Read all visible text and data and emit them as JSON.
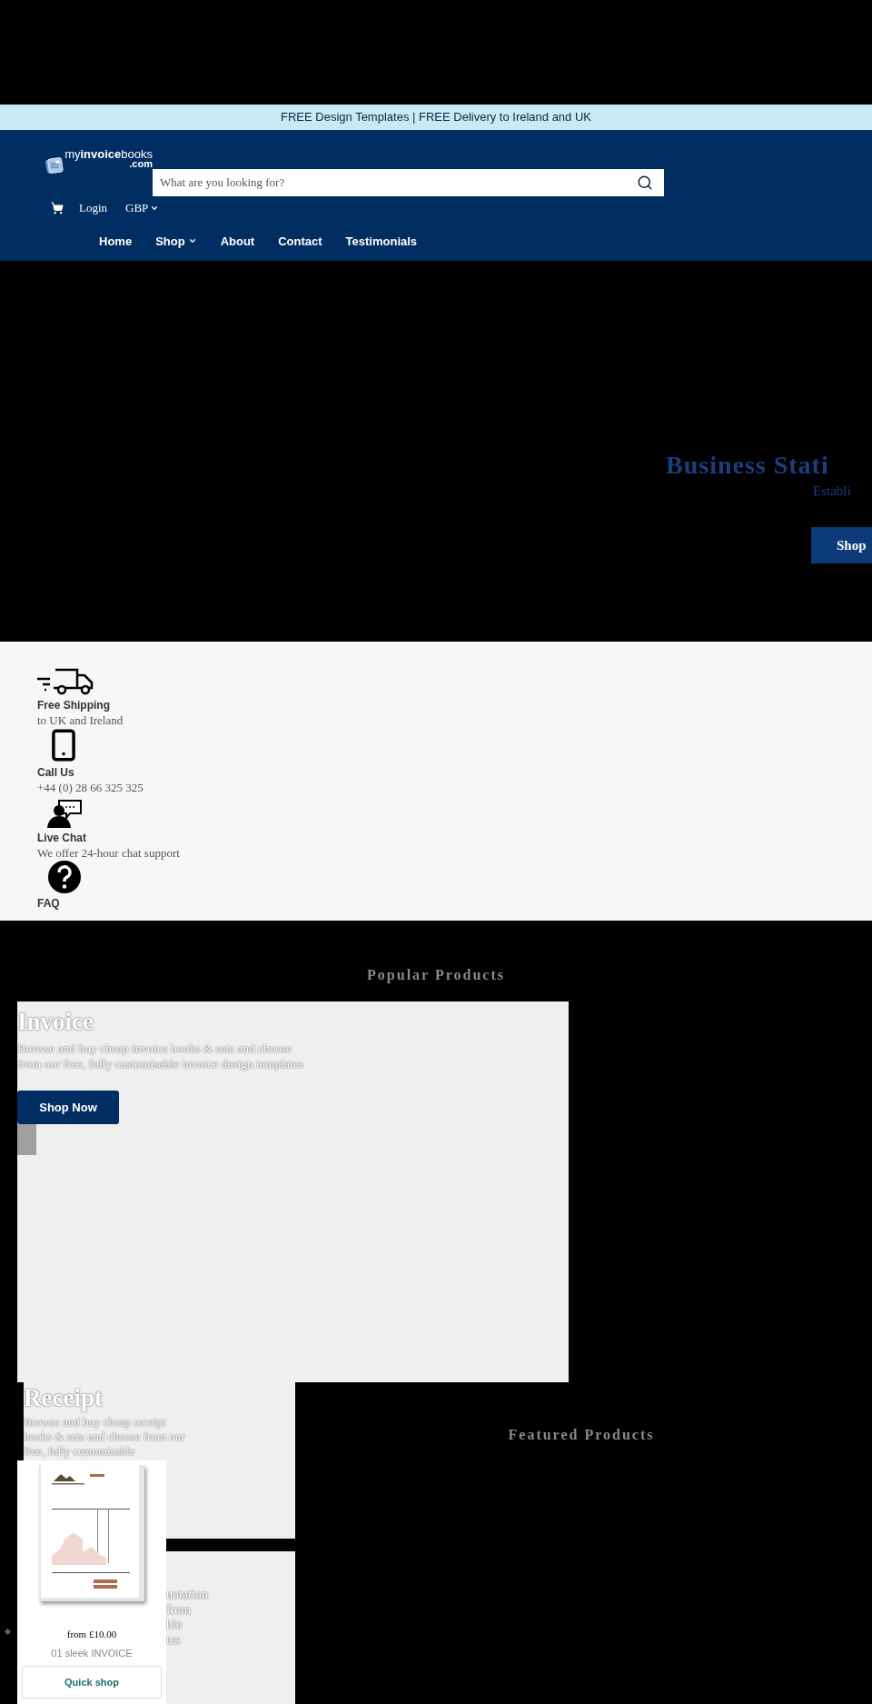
{
  "announcement": "FREE Design Templates | FREE Delivery to Ireland and UK",
  "header": {
    "logo": {
      "name": "my**invoice**books",
      "suffix": ".com"
    },
    "search": {
      "placeholder": "What are you looking for?"
    },
    "login": "Login",
    "currency": "GBP"
  },
  "nav": [
    {
      "label": "Home",
      "dropdown": false
    },
    {
      "label": "Shop",
      "dropdown": true
    },
    {
      "label": "About",
      "dropdown": false
    },
    {
      "label": "Contact",
      "dropdown": false
    },
    {
      "label": "Testimonials",
      "dropdown": false
    }
  ],
  "hero": {
    "title": "Business Stati",
    "subtitle": "Establi",
    "button": "Shop"
  },
  "features": [
    {
      "kind": "truck",
      "title": "Free Shipping",
      "text": "to UK and Ireland"
    },
    {
      "kind": "phone",
      "title": "Call Us",
      "text": "+44 (0) 28 66 325 325"
    },
    {
      "kind": "chat",
      "title": "Live Chat",
      "text": "We offer 24-hour chat support"
    },
    {
      "kind": "faq",
      "title": "FAQ"
    }
  ],
  "popular_products": {
    "title": "Popular Products",
    "categories": [
      {
        "title": "Invoice",
        "description": "Browse and buy cheap invoice books & sets and choose from our free, fully customisable invoice design templates",
        "button": "Shop Now"
      },
      {
        "title": "Receipt",
        "description": "Browse and buy cheap receipt books & sets and choose from our free, fully customisable"
      },
      {
        "fragments": [
          "uotation",
          "from",
          "ble",
          "tes"
        ]
      }
    ]
  },
  "featured_products": {
    "title": "Featured Products",
    "products": [
      {
        "price": "from £10.00",
        "name": "01 sleek INVOICE",
        "button": "Quick shop"
      }
    ]
  }
}
